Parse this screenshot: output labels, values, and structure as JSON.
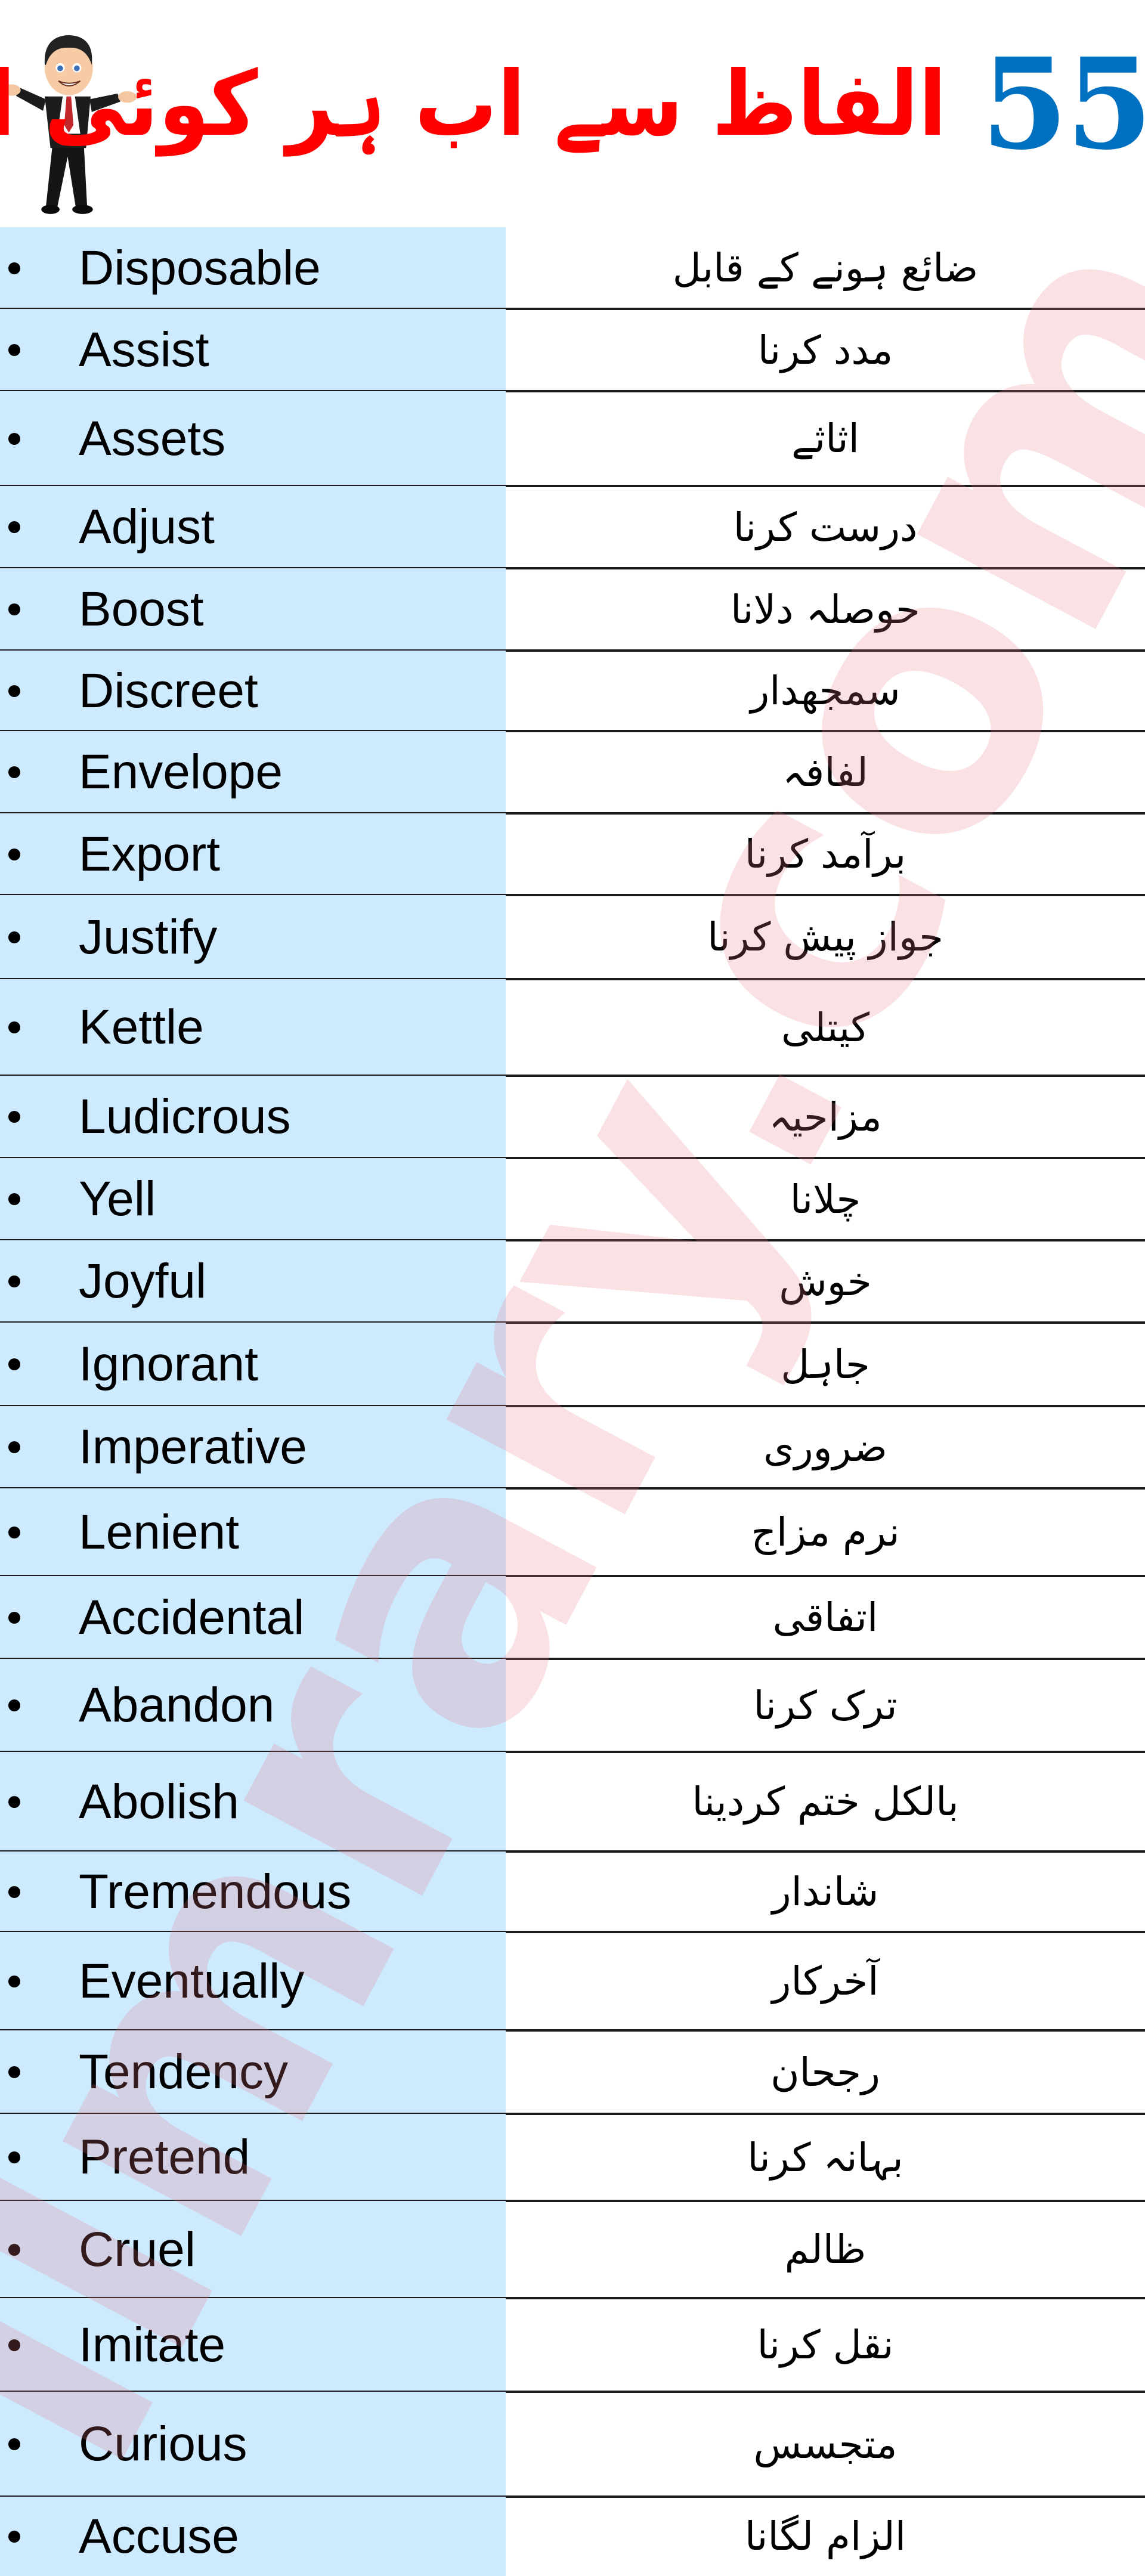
{
  "header": {
    "title_number": "55",
    "title_urdu": "الفاظ سے اب ہر کوئی انگلش بولے",
    "mascot": "businessman-cartoon-icon",
    "colors": {
      "title_number": "#0070c0",
      "title_urdu": "#ff0000"
    }
  },
  "table": {
    "colors": {
      "english_column_bg": "#cdeaff",
      "divider": "#1a1a1a"
    },
    "rows": [
      {
        "english": "Disposable",
        "urdu": "ضائع ہونے کے قابل"
      },
      {
        "english": "Assist",
        "urdu": "مدد کرنا"
      },
      {
        "english": "Assets",
        "urdu": "اثاثے"
      },
      {
        "english": "Adjust",
        "urdu": "درست کرنا"
      },
      {
        "english": "Boost",
        "urdu": "حوصلہ دلانا"
      },
      {
        "english": "Discreet",
        "urdu": "سمجھدار"
      },
      {
        "english": "Envelope",
        "urdu": "لفافہ"
      },
      {
        "english": "Export",
        "urdu": "برآمد کرنا"
      },
      {
        "english": "Justify",
        "urdu": "جواز پیش کرنا"
      },
      {
        "english": "Kettle",
        "urdu": "کیتلی"
      },
      {
        "english": "Ludicrous",
        "urdu": "مزاحیہ"
      },
      {
        "english": "Yell",
        "urdu": "چلانا"
      },
      {
        "english": "Joyful",
        "urdu": "خوش"
      },
      {
        "english": "Ignorant",
        "urdu": "جاہل"
      },
      {
        "english": "Imperative",
        "urdu": "ضروری"
      },
      {
        "english": "Lenient",
        "urdu": "نرم مزاج"
      },
      {
        "english": "Accidental",
        "urdu": "اتفاقی"
      },
      {
        "english": "Abandon",
        "urdu": "ترک کرنا"
      },
      {
        "english": "Abolish",
        "urdu": "بالکل ختم کردینا"
      },
      {
        "english": "Tremendous",
        "urdu": "شاندار"
      },
      {
        "english": "Eventually",
        "urdu": "آخرکار"
      },
      {
        "english": "Tendency",
        "urdu": "رجحان"
      },
      {
        "english": "Pretend",
        "urdu": "بہانہ کرنا"
      },
      {
        "english": "Cruel",
        "urdu": "ظالم"
      },
      {
        "english": "Imitate",
        "urdu": "نقل کرنا"
      },
      {
        "english": "Curious",
        "urdu": "متجسس"
      },
      {
        "english": "Accuse",
        "urdu": "الزام لگانا"
      }
    ]
  },
  "watermark": {
    "text": "ilmrary.com"
  }
}
